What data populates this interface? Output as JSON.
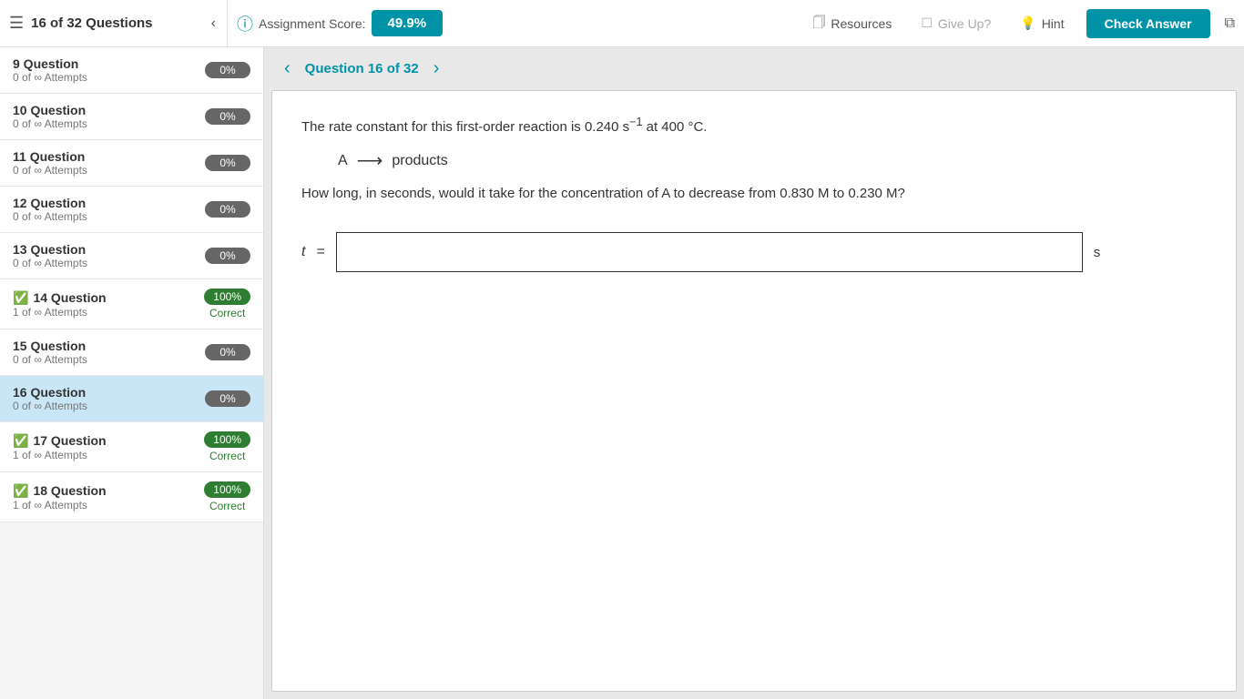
{
  "header": {
    "title": "16 of 32 Questions",
    "assignment_label": "Assignment Score:",
    "score": "49.9%",
    "resources_label": "Resources",
    "give_up_label": "Give Up?",
    "hint_label": "Hint",
    "check_answer_label": "Check Answer"
  },
  "sidebar": {
    "items": [
      {
        "id": 9,
        "name": "9 Question",
        "attempts": "0 of ∞ Attempts",
        "progress": "0%",
        "correct": false,
        "has_check": false
      },
      {
        "id": 10,
        "name": "10 Question",
        "attempts": "0 of ∞ Attempts",
        "progress": "0%",
        "correct": false,
        "has_check": false
      },
      {
        "id": 11,
        "name": "11 Question",
        "attempts": "0 of ∞ Attempts",
        "progress": "0%",
        "correct": false,
        "has_check": false
      },
      {
        "id": 12,
        "name": "12 Question",
        "attempts": "0 of ∞ Attempts",
        "progress": "0%",
        "correct": false,
        "has_check": false
      },
      {
        "id": 13,
        "name": "13 Question",
        "attempts": "0 of ∞ Attempts",
        "progress": "0%",
        "correct": false,
        "has_check": false
      },
      {
        "id": 14,
        "name": "14 Question",
        "attempts": "1 of ∞ Attempts",
        "progress": "100%",
        "correct": true,
        "correct_label": "Correct",
        "has_check": true
      },
      {
        "id": 15,
        "name": "15 Question",
        "attempts": "0 of ∞ Attempts",
        "progress": "0%",
        "correct": false,
        "has_check": false
      },
      {
        "id": 16,
        "name": "16 Question",
        "attempts": "0 of ∞ Attempts",
        "progress": "0%",
        "correct": false,
        "has_check": false,
        "active": true
      },
      {
        "id": 17,
        "name": "17 Question",
        "attempts": "1 of ∞ Attempts",
        "progress": "100%",
        "correct": true,
        "correct_label": "Correct",
        "has_check": true
      },
      {
        "id": 18,
        "name": "18 Question",
        "attempts": "1 of ∞ Attempts",
        "progress": "100%",
        "correct": true,
        "correct_label": "Correct",
        "has_check": true
      }
    ]
  },
  "question": {
    "nav_label": "Question 16 of 32",
    "line1": "The rate constant for this first-order reaction is 0.240 s",
    "superscript": "−1",
    "line1_end": " at 400 °C.",
    "reactant": "A",
    "arrow": "⟶",
    "products": "products",
    "line2": "How long, in seconds, would it take for the concentration of A to decrease from 0.830 M to 0.230 M?",
    "t_label": "t",
    "equals": "=",
    "unit": "s",
    "answer_value": "",
    "answer_placeholder": ""
  }
}
